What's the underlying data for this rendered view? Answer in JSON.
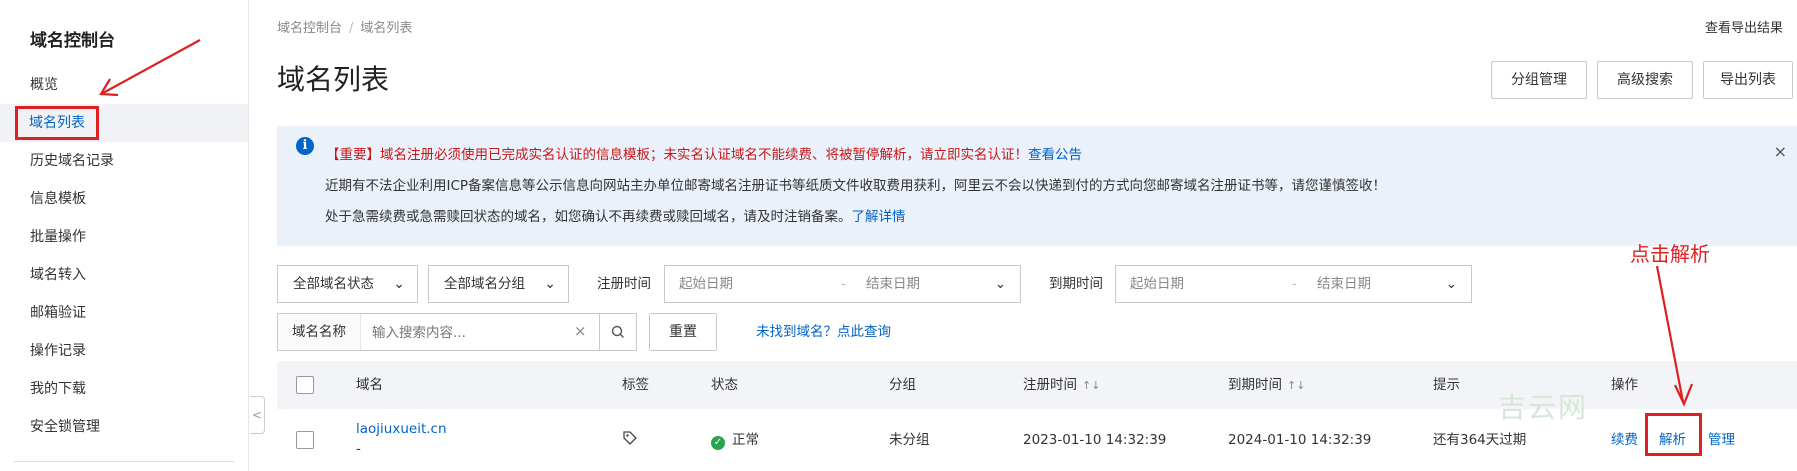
{
  "sidebar": {
    "title": "域名控制台",
    "items": [
      {
        "label": "概览"
      },
      {
        "label": "域名列表"
      },
      {
        "label": "历史域名记录"
      },
      {
        "label": "信息模板"
      },
      {
        "label": "批量操作"
      },
      {
        "label": "域名转入"
      },
      {
        "label": "邮箱验证"
      },
      {
        "label": "操作记录"
      },
      {
        "label": "我的下载"
      },
      {
        "label": "安全锁管理"
      }
    ],
    "collapse_glyph": "<"
  },
  "breadcrumb": {
    "root": "域名控制台",
    "sep": "/",
    "current": "域名列表"
  },
  "header": {
    "export_result": "查看导出结果",
    "title": "域名列表",
    "buttons": {
      "group_manage": "分组管理",
      "advanced_search": "高级搜索",
      "export_list": "导出列表"
    }
  },
  "notice": {
    "line1": "【重要】域名注册必须使用已完成实名认证的信息模板；未实名认证域名不能续费、将被暂停解析，请立即实名认证！",
    "line1_link": "查看公告",
    "line2": "近期有不法企业利用ICP备案信息等公示信息向网站主办单位邮寄域名注册证书等纸质文件收取费用获利，阿里云不会以快递到付的方式向您邮寄域名注册证书等，请您谨慎签收！",
    "line3": "处于急需续费或急需赎回状态的域名，如您确认不再续费或赎回域名，请及时注销备案。",
    "line3_link": "了解详情",
    "close": "×"
  },
  "filters": {
    "status_select": "全部域名状态",
    "group_select": "全部域名分组",
    "reg_time_label": "注册时间",
    "exp_time_label": "到期时间",
    "start_placeholder": "起始日期",
    "end_placeholder": "结束日期",
    "range_dash": "-",
    "search_label": "域名名称",
    "search_placeholder": "输入搜索内容...",
    "search_clear": "×",
    "reset": "重置",
    "not_found": "未找到域名？点此查询"
  },
  "table": {
    "columns": {
      "domain": "域名",
      "tag": "标签",
      "status": "状态",
      "group": "分组",
      "reg_time": "注册时间",
      "exp_time": "到期时间",
      "hint": "提示",
      "action": "操作"
    },
    "sort_glyph": "↑↓",
    "rows": [
      {
        "domain": "laojiuxueit.cn",
        "sub": "-",
        "status": "正常",
        "group": "未分组",
        "reg_time": "2023-01-10 14:32:39",
        "exp_time": "2024-01-10 14:32:39",
        "hint": "还有364天过期",
        "actions": {
          "renew": "续费",
          "resolve": "解析",
          "manage": "管理"
        }
      }
    ]
  },
  "watermark": "吉云网",
  "annotation": {
    "text": "点击解析",
    "color": "#e02020"
  },
  "colors": {
    "accent": "#0064c8",
    "warning": "#c81818",
    "success": "#2aa44f",
    "notice_bg": "#eaf1fa",
    "header_bg": "#f2f4f7"
  }
}
